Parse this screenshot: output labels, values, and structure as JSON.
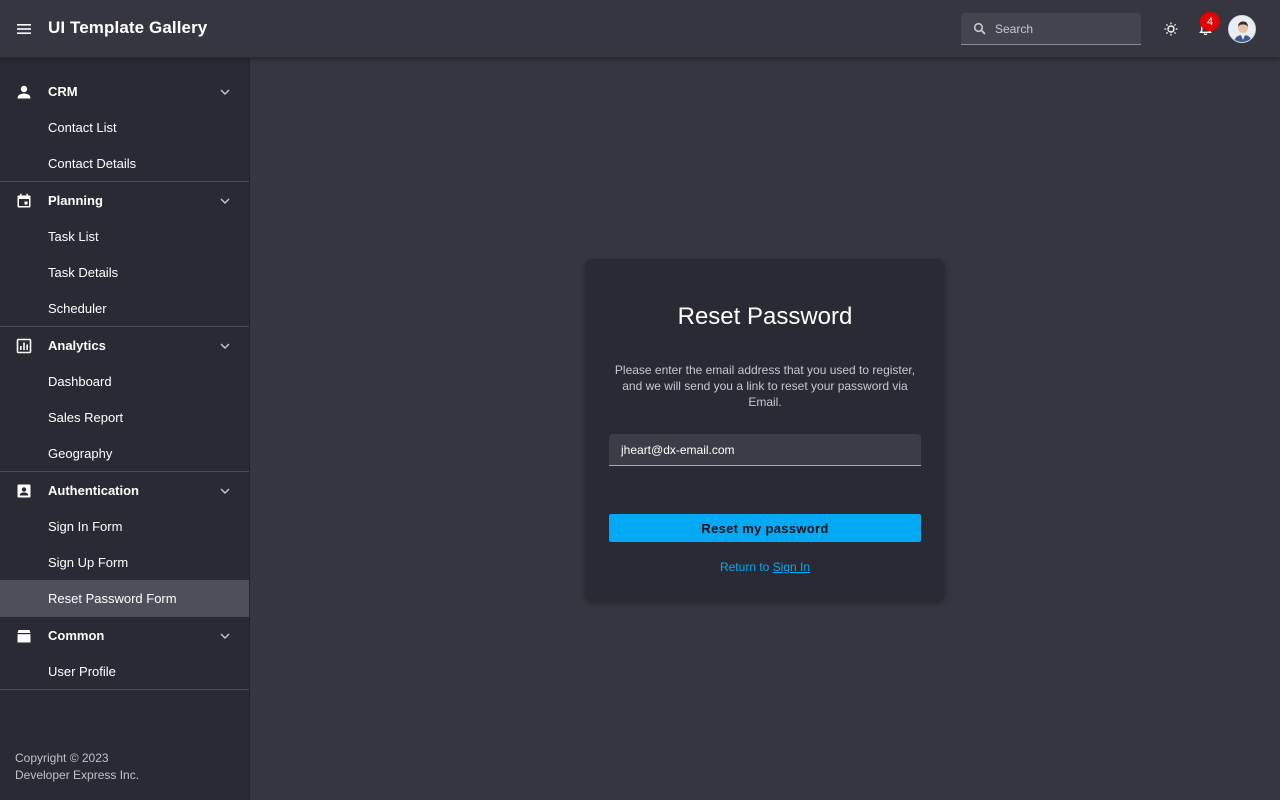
{
  "header": {
    "app_title": "UI Template Gallery",
    "search_placeholder": "Search",
    "notification_count": "4"
  },
  "sidebar": {
    "groups": [
      {
        "label": "CRM",
        "icon": "person-icon",
        "items": [
          "Contact List",
          "Contact Details"
        ]
      },
      {
        "label": "Planning",
        "icon": "calendar-icon",
        "items": [
          "Task List",
          "Task Details",
          "Scheduler"
        ]
      },
      {
        "label": "Analytics",
        "icon": "chart-icon",
        "items": [
          "Dashboard",
          "Sales Report",
          "Geography"
        ]
      },
      {
        "label": "Authentication",
        "icon": "contact-card-icon",
        "items": [
          "Sign In Form",
          "Sign Up Form",
          "Reset Password Form"
        ]
      },
      {
        "label": "Common",
        "icon": "box-icon",
        "items": [
          "User Profile"
        ]
      }
    ],
    "active_item": "Reset Password Form",
    "copyright_line1": "Copyright © 2023",
    "copyright_line2": "Developer Express Inc."
  },
  "form": {
    "title": "Reset Password",
    "description": "Please enter the email address that you used to register, and we will send you a link to reset your password via Email.",
    "email_value": "jheart@dx-email.com",
    "submit_label": "Reset my password",
    "return_text": "Return to",
    "signin_link": "Sign In"
  },
  "colors": {
    "accent": "#03a9f4",
    "badge": "#e40000",
    "sidebar_bg": "#2a2a34",
    "content_bg": "#363640",
    "active_item_bg": "#4f4f5b"
  }
}
